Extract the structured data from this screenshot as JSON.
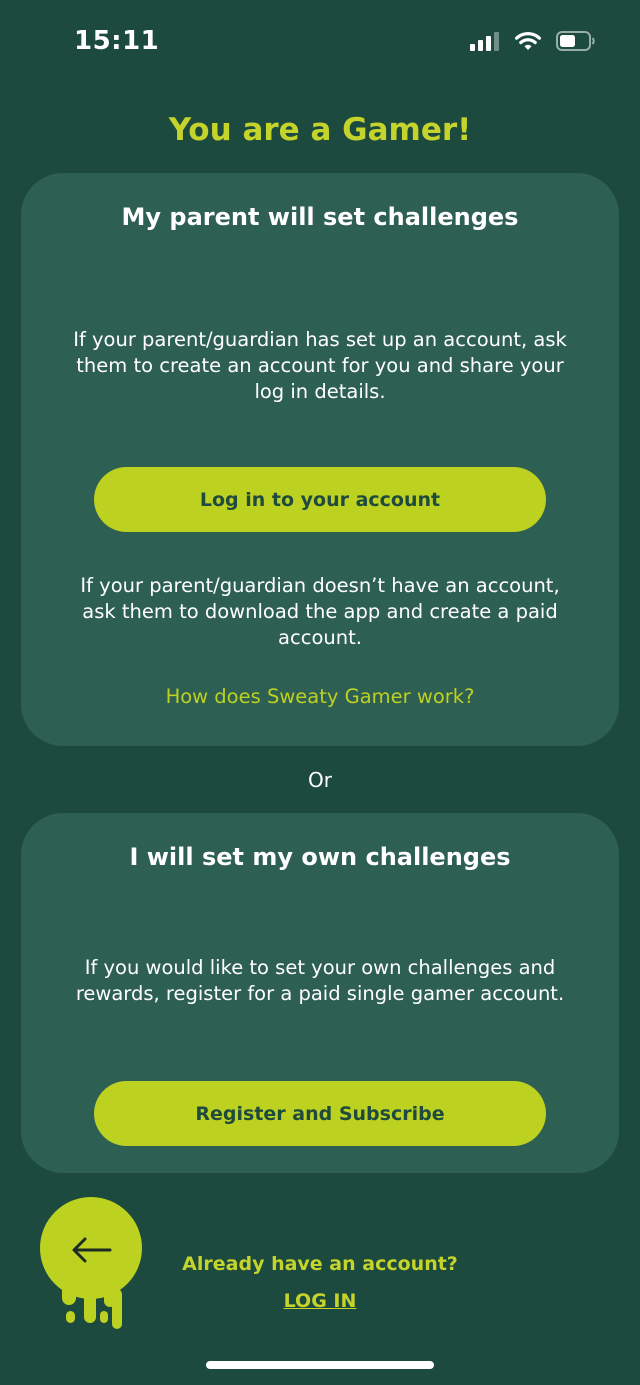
{
  "status_bar": {
    "time": "15:11",
    "icons": [
      "cellular-signal-icon",
      "wifi-icon",
      "battery-icon"
    ]
  },
  "page_title": "You are a Gamer!",
  "parent_card": {
    "title": "My parent will set challenges",
    "text1": "If your parent/guardian has set up an account, ask them to create an account for you and share your log in details.",
    "button_label": "Log in to your account",
    "text2": "If your parent/guardian doesn’t have an account, ask them to download the app and create a paid account.",
    "link_label": "How does Sweaty Gamer work?"
  },
  "or_label": "Or",
  "own_card": {
    "title": "I will set my own challenges",
    "text": "If you would like to set your own challenges and rewards, register for a paid single gamer account.",
    "button_label": "Register and Subscribe"
  },
  "footer": {
    "back_icon": "arrow-left-icon",
    "already_text": "Already have an account?",
    "login_label": "LOG IN"
  },
  "colors": {
    "background": "#1c4a3e",
    "card": "#2e5f53",
    "accent": "#bdd120",
    "title": "#c4d42b"
  }
}
